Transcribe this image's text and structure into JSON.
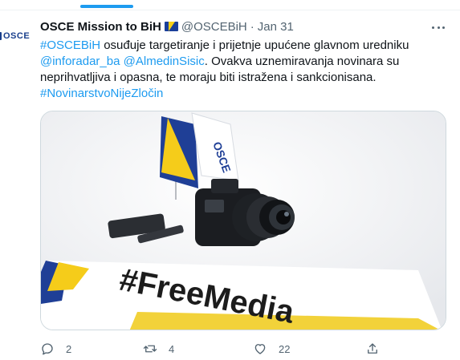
{
  "account": {
    "display_name": "OSCE Mission to BiH",
    "handle": "@OSCEBiH",
    "separator": "·",
    "date": "Jan 31",
    "avatar_text": "OSCE"
  },
  "tweet": {
    "segments": [
      {
        "text": "#OSCEBiH",
        "type": "link"
      },
      {
        "text": " osuđuje targetiranje i prijetnje upućene glavnom uredniku ",
        "type": "text"
      },
      {
        "text": "@inforadar_ba",
        "type": "link"
      },
      {
        "text": " ",
        "type": "text"
      },
      {
        "text": "@AlmedinSisic",
        "type": "link"
      },
      {
        "text": ". Ovakva uznemiravanja novinara su neprihvatljiva i opasna, te moraju biti istražena i sankcionisana.",
        "type": "text"
      },
      {
        "text": "#NovinarstvoNijeZločin",
        "type": "link"
      }
    ]
  },
  "media": {
    "sign_text": "#FreeMedia",
    "flag_text": "OSCE"
  },
  "actions": {
    "replies": "2",
    "retweets": "4",
    "likes": "22"
  },
  "colors": {
    "accent": "#1d9bf0",
    "secondary_text": "#536471",
    "primary_text": "#0f1419",
    "border": "#cfd9de"
  },
  "icons": {
    "more": "more-horizontal-icon",
    "reply": "reply-icon",
    "retweet": "retweet-icon",
    "like": "heart-icon",
    "share": "share-icon"
  }
}
